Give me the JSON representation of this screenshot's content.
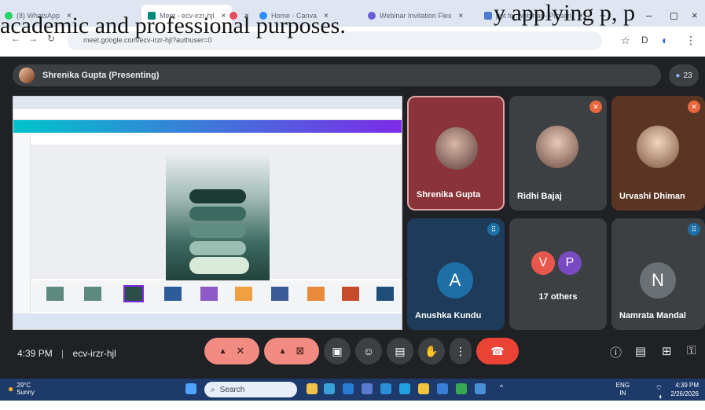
{
  "overlay_text": "academic and professional purposes.",
  "overlay_text_top": "y applying p, p",
  "browser": {
    "tabs": [
      {
        "label": "(8) WhatsApp",
        "color": "#25d366"
      },
      {
        "label": "Meet - ecv-irzr-hjl",
        "color": "#00897b"
      },
      {
        "label": "",
        "color": "#e84a5f"
      },
      {
        "label": "Home - Canva",
        "color": "#2d8cff"
      },
      {
        "label": "Webinar Invitation Flex",
        "color": "#6b5bd8"
      },
      {
        "label": "ppt for webinar - Presen",
        "color": "#4a7bd0"
      }
    ],
    "new_tab": "+",
    "win_min": "–",
    "win_max": "◻",
    "win_close": "×",
    "url": "meet.google.com/ecv-irzr-hjl?authuser=0",
    "tool_star": "☆",
    "tool_ext": "D",
    "tool_profile": "◐",
    "tool_more": "⋮"
  },
  "meet": {
    "presenting_title": "Shrenika Gupta (Presenting)",
    "participants_count": "23",
    "tiles": [
      {
        "name": "Shrenika Gupta"
      },
      {
        "name": "Ridhi Bajaj"
      },
      {
        "name": "Urvashi Dhiman"
      },
      {
        "name": "Anushka Kundu",
        "letter": "A"
      },
      {
        "name": "17 others",
        "v": "V",
        "p": "P"
      },
      {
        "name": "Namrata Mandal",
        "letter": "N"
      }
    ],
    "time": "4:39 PM",
    "divider": "|",
    "meeting_code": "ecv-irzr-hjl"
  },
  "taskbar": {
    "temp": "29°C",
    "weather": "Sunny",
    "search_placeholder": "Search",
    "lang": "ENG",
    "lang2": "IN",
    "clock": "4:39 PM",
    "date": "2/26/2026"
  },
  "colors": {
    "meet_bg": "#202124",
    "end_call": "#ea4335",
    "muted": "#f28b82",
    "tile_dark": "#3c4043",
    "tile_blue": "#1f3b5a",
    "taskbar": "#1d3a6a"
  }
}
